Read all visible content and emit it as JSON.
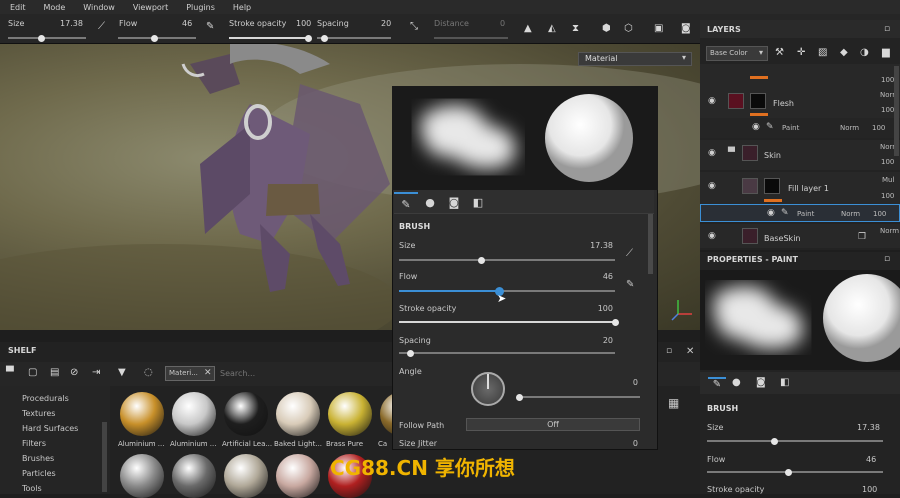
{
  "menu": [
    "Edit",
    "Mode",
    "Window",
    "Viewport",
    "Plugins",
    "Help"
  ],
  "toolbar": {
    "size_label": "Size",
    "size_value": "17.38",
    "flow_label": "Flow",
    "flow_value": "46",
    "stroke_label": "Stroke opacity",
    "stroke_value": "100",
    "spacing_label": "Spacing",
    "spacing_value": "20",
    "distance_label": "Distance",
    "distance_value": "0"
  },
  "viewport": {
    "material_mode": "Material"
  },
  "shelf": {
    "title": "SHELF",
    "filter_tag": "Materi...",
    "search_placeholder": "Search...",
    "categories": [
      "Procedurals",
      "Textures",
      "Hard Surfaces",
      "Filters",
      "Brushes",
      "Particles",
      "Tools"
    ],
    "materials": [
      {
        "label": "Aluminium ...",
        "color": "#c8902a"
      },
      {
        "label": "Aluminium ...",
        "color": "#c8c8c8"
      },
      {
        "label": "Artificial Lea...",
        "color": "#1e1e1e"
      },
      {
        "label": "Baked Light...",
        "color": "#d8cbb8"
      },
      {
        "label": "Brass Pure",
        "color": "#c9b233"
      },
      {
        "label": "Ca",
        "color": "#8a6a2a"
      }
    ],
    "materials_row2": [
      "#8a8a8a",
      "#6a6a6a",
      "#b0a898",
      "#c8a8a0",
      "#b02020",
      "#7a7a7a",
      "#a05a3a",
      "#7a7a7a",
      "#3a5a6a"
    ]
  },
  "brush_popup": {
    "section": "BRUSH",
    "size_label": "Size",
    "size_value": "17.38",
    "size_level": 0.38,
    "flow_label": "Flow",
    "flow_value": "46",
    "flow_level": 0.46,
    "stroke_label": "Stroke opacity",
    "stroke_value": "100",
    "stroke_level": 1.0,
    "spacing_label": "Spacing",
    "spacing_value": "20",
    "spacing_level": 0.05,
    "angle_label": "Angle",
    "angle_value": "0",
    "follow_label": "Follow Path",
    "follow_value": "Off",
    "jitter_label": "Size Jitter",
    "jitter_value": "0"
  },
  "layers": {
    "title": "LAYERS",
    "channel": "Base Color",
    "rows": [
      {
        "name": "Flesh",
        "blend": "Norm",
        "opacity": "100"
      },
      {
        "name": "Paint",
        "blend": "Norm",
        "opacity": "100"
      },
      {
        "name": "Skin",
        "blend": "Norm",
        "opacity": "100"
      },
      {
        "name": "Fill layer 1",
        "blend": "Mul",
        "opacity": "100"
      },
      {
        "name": "Paint",
        "blend": "Norm",
        "opacity": "100"
      },
      {
        "name": "BaseSkin",
        "blend": "Norm",
        "opacity": ""
      }
    ],
    "top_opacity": "100"
  },
  "properties": {
    "title": "PROPERTIES - PAINT",
    "section": "BRUSH",
    "size_label": "Size",
    "size_value": "17.38",
    "size_level": 0.38,
    "flow_label": "Flow",
    "flow_value": "46",
    "flow_level": 0.46,
    "stroke_label": "Stroke opacity",
    "stroke_value": "100"
  },
  "watermark": "CG88.CN 享你所想"
}
